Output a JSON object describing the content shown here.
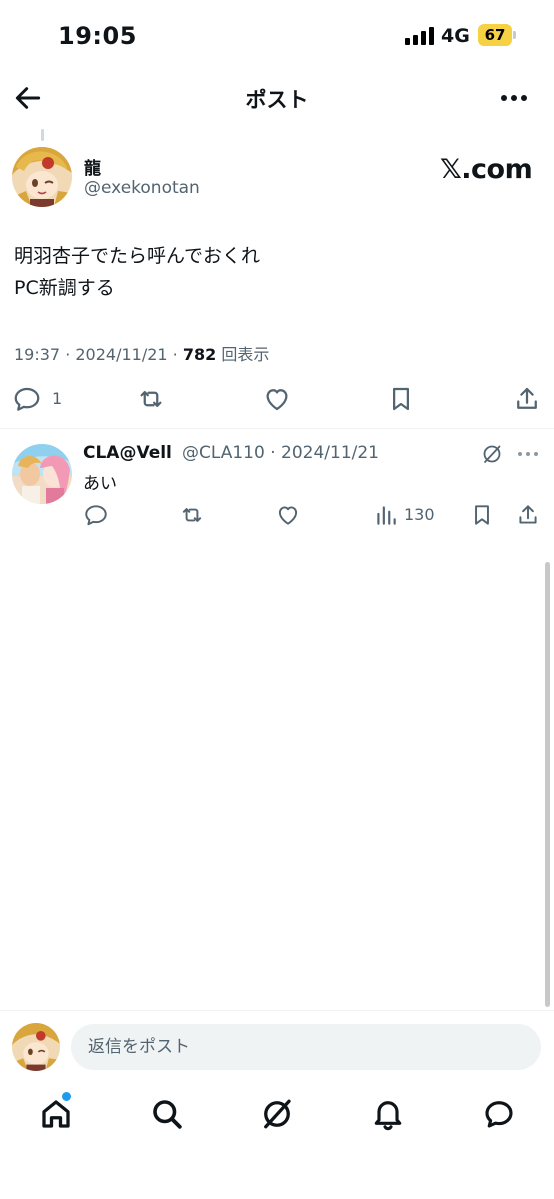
{
  "status_bar": {
    "time": "19:05",
    "network": "4G",
    "battery": "67"
  },
  "header": {
    "title": "ポスト",
    "back_icon": "arrow-left-icon",
    "more_icon": "more-horizontal-icon"
  },
  "post": {
    "author_name": "龍",
    "author_handle": "@exekonotan",
    "source": "𝕏.com",
    "text_lines": [
      "明羽杏子でたら呼んでおくれ",
      "PC新調する"
    ],
    "meta_time": "19:37 · 2024/11/21 · ",
    "meta_views": "782",
    "meta_views_label": " 回表示",
    "reply_count": "1"
  },
  "reply": {
    "name": "CLA@Vell",
    "handle_date": "@CLA110 · 2024/11/21",
    "text": "あい",
    "views": "130"
  },
  "composer": {
    "placeholder": "返信をポスト"
  },
  "colors": {
    "accent": "#1d9bf0",
    "text": "#0f1419",
    "muted": "#536471",
    "battery": "#f6d143"
  }
}
